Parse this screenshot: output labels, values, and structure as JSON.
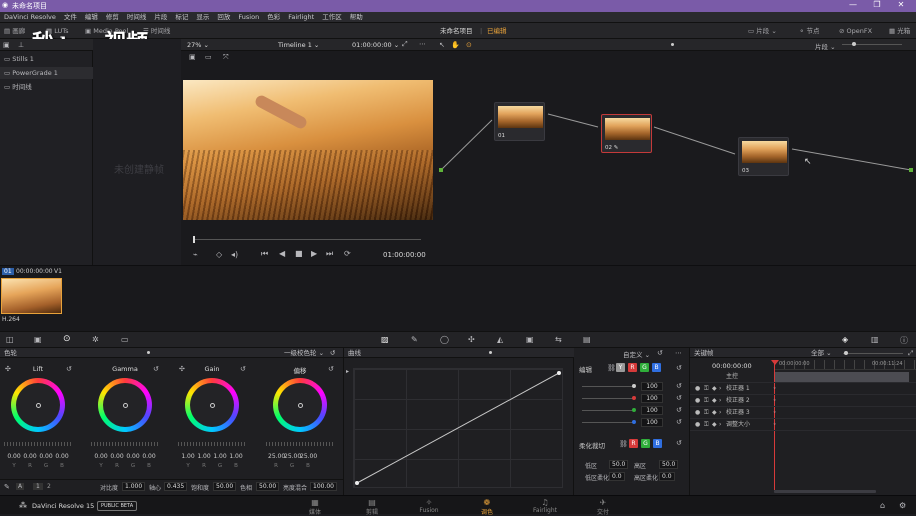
{
  "window": {
    "title": "未命名项目",
    "controls": [
      "—",
      "❐",
      "✕"
    ]
  },
  "menu": [
    "DaVinci Resolve",
    "文件",
    "编辑",
    "修剪",
    "时间线",
    "片段",
    "标记",
    "显示",
    "回放",
    "Fusion",
    "色彩",
    "Fairlight",
    "工作区",
    "帮助"
  ],
  "toolbar": {
    "gallery": "画廊",
    "luts": "LUTs",
    "media_pool": "Media Pool",
    "timelines": "时间线",
    "project_title": "未命名项目",
    "project_status": "已编辑",
    "clip_label": "片段",
    "nodes_label": "节点",
    "openfx_label": "OpenFX",
    "lightbox_label": "光箱"
  },
  "watermark": {
    "part1": "秒",
    "part2": "dong",
    "part3": "视频"
  },
  "left_panel": {
    "items": [
      "Stills 1",
      "PowerGrade 1",
      "时间线"
    ]
  },
  "gallery_placeholder": "未创建静帧",
  "viewer": {
    "zoom": "27%",
    "timeline_name": "Timeline 1",
    "timecode": "01:00:00:00",
    "playback_timecode": "01:00:00:00",
    "transport_icons": [
      "⏮",
      "◀",
      "■",
      "▶",
      "⏭",
      "⟳"
    ]
  },
  "node_graph": {
    "mode": "片段",
    "nodes": [
      {
        "id": "01",
        "label": "01"
      },
      {
        "id": "02",
        "label": "02 ✎"
      },
      {
        "id": "03",
        "label": "03"
      }
    ]
  },
  "clip_strip": {
    "clip_number": "01",
    "timecode": "00:00:00:00",
    "track": "V1",
    "codec": "H.264"
  },
  "color_panel": {
    "title": "色轮",
    "mode": "一级校色轮",
    "wheels": [
      {
        "name": "Lift",
        "values": [
          "0.00",
          "0.00",
          "0.00",
          "0.00"
        ]
      },
      {
        "name": "Gamma",
        "values": [
          "0.00",
          "0.00",
          "0.00",
          "0.00"
        ]
      },
      {
        "name": "Gain",
        "values": [
          "1.00",
          "1.00",
          "1.00",
          "1.00"
        ]
      },
      {
        "name": "偏移",
        "values": [
          "25.00",
          "25.00",
          "25.00",
          ""
        ]
      }
    ],
    "channel_letters": [
      "Y",
      "R",
      "G",
      "B"
    ],
    "page_numbers": [
      "1",
      "2"
    ],
    "footer": [
      {
        "label": "对比度",
        "value": "1.000"
      },
      {
        "label": "轴心",
        "value": "0.435"
      },
      {
        "label": "饱和度",
        "value": "50.00"
      },
      {
        "label": "色相",
        "value": "50.00"
      },
      {
        "label": "亮度混合",
        "value": "100.00"
      }
    ]
  },
  "curves": {
    "title": "曲线",
    "mode": "自定义"
  },
  "curve_edit": {
    "title": "编辑",
    "channels": [
      "Y",
      "R",
      "G",
      "B"
    ],
    "channel_colors": [
      "#9a9a9a",
      "#d63a3a",
      "#2fae3a",
      "#2f6ee0"
    ],
    "intensities": [
      "100",
      "100",
      "100",
      "100"
    ],
    "soft_clip_title": "柔化裁切",
    "soft_clip": [
      {
        "label": "低区",
        "value": "50.0"
      },
      {
        "label": "高区",
        "value": "50.0"
      },
      {
        "label": "低区柔化",
        "value": "0.0"
      },
      {
        "label": "高区柔化",
        "value": "0.0"
      }
    ]
  },
  "keyframes": {
    "title": "关键帧",
    "filter": "全部",
    "timecode": "00:00:00:00",
    "timecode_end": "00:00:11:24",
    "rows": [
      "主控",
      "校正器 1",
      "校正器 2",
      "校正器 3",
      "调整大小"
    ]
  },
  "page_bar": {
    "app": "DaVinci Resolve 15",
    "badge": "PUBLIC BETA",
    "pages": [
      {
        "name": "媒体",
        "icon": "▦"
      },
      {
        "name": "剪辑",
        "icon": "▤"
      },
      {
        "name": "Fusion",
        "icon": "✧"
      },
      {
        "name": "调色",
        "icon": "❁"
      },
      {
        "name": "Fairlight",
        "icon": "♫"
      },
      {
        "name": "交付",
        "icon": "✈"
      }
    ]
  }
}
